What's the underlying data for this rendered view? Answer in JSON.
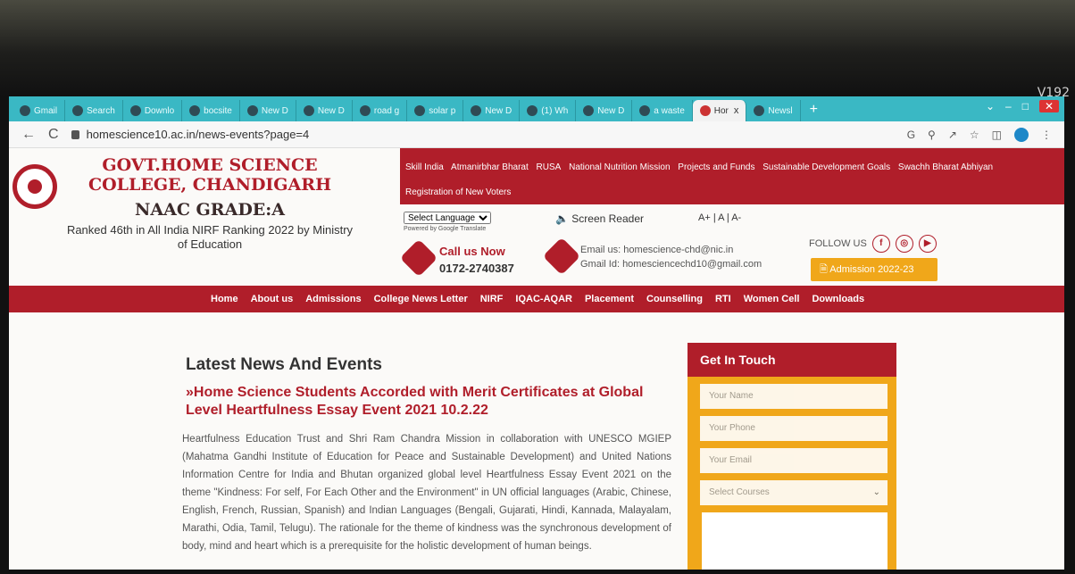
{
  "monitor": {
    "label": "V192"
  },
  "browser": {
    "tabs": [
      {
        "label": "Gmail"
      },
      {
        "label": "Search"
      },
      {
        "label": "Downlo"
      },
      {
        "label": "bocsite"
      },
      {
        "label": "New D"
      },
      {
        "label": "New D"
      },
      {
        "label": "road g"
      },
      {
        "label": "solar p"
      },
      {
        "label": "New D"
      },
      {
        "label": "(1) Wh"
      },
      {
        "label": "New D"
      },
      {
        "label": "a waste"
      },
      {
        "label": "Hor"
      },
      {
        "label": "Newsl"
      }
    ],
    "new_tab": "+",
    "back": "←",
    "forward": "→",
    "reload": "C",
    "url": "homescience10.ac.in/news-events?page=4",
    "tab_close": "x"
  },
  "site": {
    "college_name": "GOVT.HOME SCIENCE COLLEGE, CHANDIGARH",
    "naac": "NAAC GRADE:A",
    "ranking": "Ranked 46th in All India NIRF Ranking 2022 by Ministry of Education",
    "top_links": [
      "Skill India",
      "Atmanirbhar Bharat",
      "RUSA",
      "National Nutrition Mission",
      "Projects and Funds",
      "Sustainable Development Goals",
      "Swachh Bharat Abhiyan",
      "Registration of New Voters"
    ],
    "select_language": "Select Language",
    "powered_by": "Powered by Google Translate",
    "screen_reader": "Screen Reader",
    "font_size": "A+ | A | A-",
    "call_label": "Call us Now",
    "phone": "0172-2740387",
    "email": "Email us: homescience-chd@nic.in",
    "gmail": "Gmail Id: homesciencechd10@gmail.com",
    "follow_us": "FOLLOW US",
    "admission_button": "Admission 2022-23",
    "nav": [
      "Home",
      "About us",
      "Admissions",
      "College News Letter",
      "NIRF",
      "IQAC-AQAR",
      "Placement",
      "Counselling",
      "RTI",
      "Women Cell",
      "Downloads"
    ]
  },
  "content": {
    "heading": "Latest News And Events",
    "article_title": "»Home Science Students Accorded with Merit Certificates at Global Level Heartfulness Essay Event 2021 10.2.22",
    "article_body": "Heartfulness Education Trust and Shri Ram Chandra Mission in collaboration with UNESCO MGIEP (Mahatma Gandhi Institute of Education for Peace and Sustainable Development) and United Nations Information Centre for India and Bhutan organized global level Heartfulness Essay Event 2021 on the theme \"Kindness: For self, For Each Other and the Environment\" in UN official languages (Arabic, Chinese, English, French, Russian, Spanish) and Indian Languages (Bengali, Gujarati, Hindi, Kannada, Malayalam, Marathi, Odia, Tamil, Telugu). The rationale for the theme of kindness was the synchronous development of body, mind and heart which is a prerequisite for the holistic development of human beings."
  },
  "contact_form": {
    "title": "Get In Touch",
    "name_placeholder": "Your Name",
    "phone_placeholder": "Your Phone",
    "email_placeholder": "Your Email",
    "course_select": "Select Courses"
  },
  "colors": {
    "brand_red": "#b01e2a",
    "accent_orange": "#f0a71a",
    "tab_strip": "#3ab8c4"
  }
}
